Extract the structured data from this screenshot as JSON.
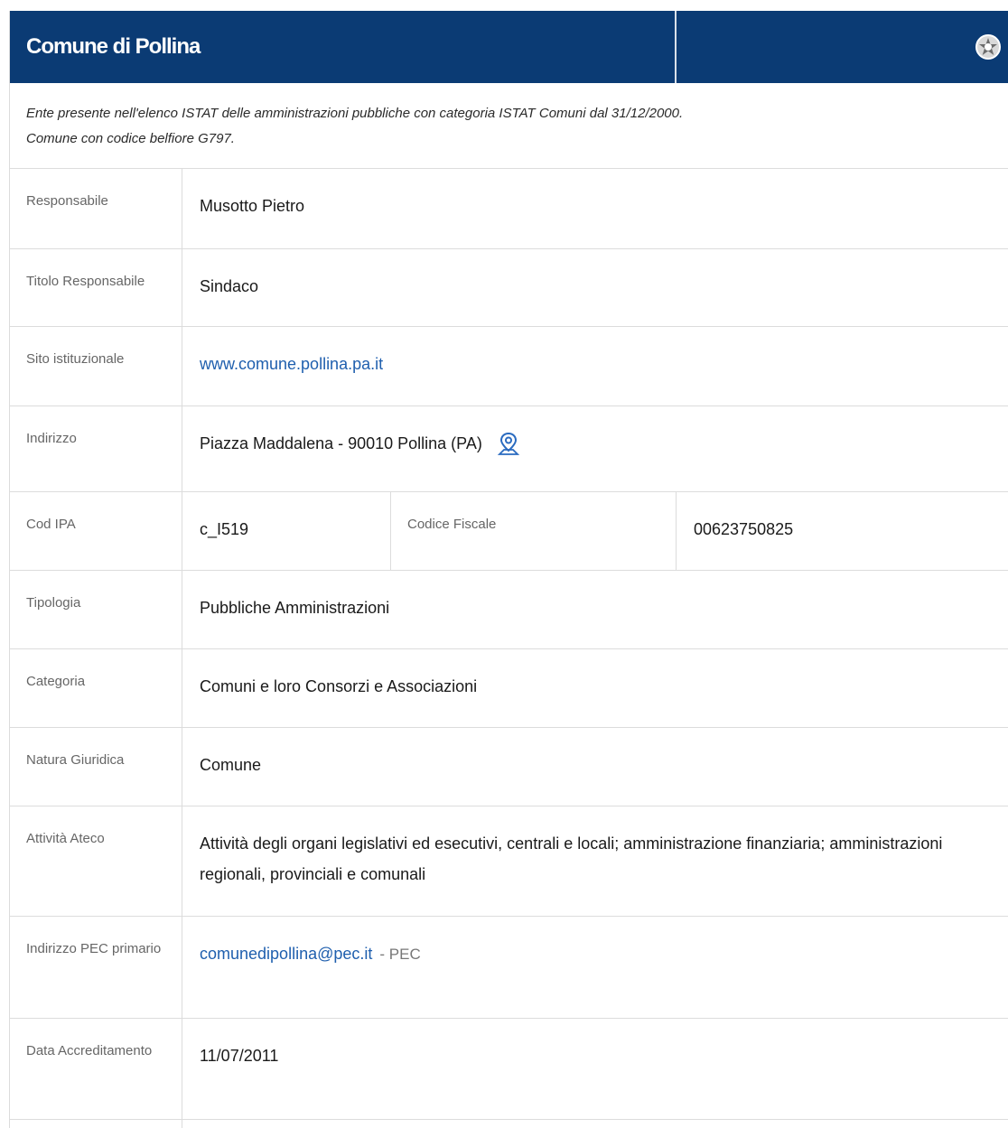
{
  "header": {
    "title": "Comune di Pollina",
    "emblem_icon": "emblem-icon"
  },
  "intro": {
    "line1": "Ente presente nell'elenco ISTAT delle amministrazioni pubbliche con categoria ISTAT Comuni dal 31/12/2000.",
    "line2": "Comune con codice belfiore G797."
  },
  "rows": {
    "responsabile": {
      "label": "Responsabile",
      "value": "Musotto Pietro"
    },
    "titolo": {
      "label": "Titolo Responsabile",
      "value": "Sindaco"
    },
    "sito": {
      "label": "Sito istituzionale",
      "value": "www.comune.pollina.pa.it"
    },
    "indirizzo": {
      "label": "Indirizzo",
      "value": "Piazza Maddalena - 90010 Pollina (PA)",
      "icon": "map-pin-icon"
    },
    "codipa": {
      "label": "Cod IPA",
      "value": "c_I519",
      "label2": "Codice Fiscale",
      "value2": "00623750825"
    },
    "tipologia": {
      "label": "Tipologia",
      "value": "Pubbliche Amministrazioni"
    },
    "categoria": {
      "label": "Categoria",
      "value": "Comuni e loro Consorzi e Associazioni"
    },
    "natura": {
      "label": "Natura Giuridica",
      "value": "Comune"
    },
    "ateco": {
      "label": "Attività Ateco",
      "value": "Attività degli organi legislativi ed esecutivi, centrali e locali; amministrazione finanziaria; amministrazioni regionali, provinciali e comunali"
    },
    "pec": {
      "label": "Indirizzo PEC primario",
      "value": "comunedipollina@pec.it",
      "suffix": "- PEC"
    },
    "accreditamento": {
      "label": "Data Accreditamento",
      "value": "11/07/2011"
    }
  },
  "colors": {
    "header_bg": "#0b3b74",
    "link": "#1f5fae",
    "border": "#dcdcdc"
  }
}
